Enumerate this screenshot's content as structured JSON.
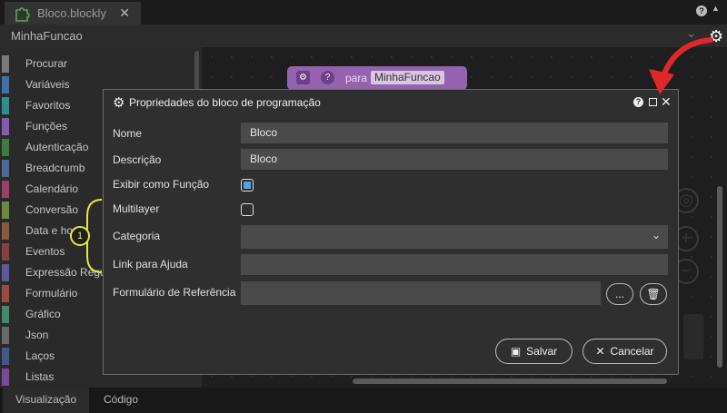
{
  "tab": {
    "title": "Bloco.blockly",
    "close": "✕",
    "icon": "puzzle-icon"
  },
  "top": {
    "help": "?"
  },
  "titlebar": {
    "function_name": "MinhaFuncao",
    "icon_settings": "gear-icon"
  },
  "sidebar": {
    "items": [
      {
        "label": "Procurar",
        "color": "#7a7a7a"
      },
      {
        "label": "Variáveis",
        "color": "#3f6fb0"
      },
      {
        "label": "Favoritos",
        "color": "#2f8f8f"
      },
      {
        "label": "Funções",
        "color": "#8a5ab0"
      },
      {
        "label": "Autenticação",
        "color": "#3f7a3f"
      },
      {
        "label": "Breadcrumb",
        "color": "#4a6a9a"
      },
      {
        "label": "Calendário",
        "color": "#9a3f6a"
      },
      {
        "label": "Conversão",
        "color": "#6a8a3f"
      },
      {
        "label": "Data e hora",
        "color": "#8a5a3f"
      },
      {
        "label": "Eventos",
        "color": "#8a3f3f"
      },
      {
        "label": "Expressão Regular",
        "color": "#5a5aa0"
      },
      {
        "label": "Formulário",
        "color": "#a04a3f"
      },
      {
        "label": "Gráfico",
        "color": "#3f8a6a"
      },
      {
        "label": "Json",
        "color": "#6a6a6a"
      },
      {
        "label": "Laços",
        "color": "#3f5a8a"
      },
      {
        "label": "Listas",
        "color": "#7a4a9a"
      }
    ]
  },
  "block": {
    "para_label": "para",
    "function_name": "MinhaFuncao"
  },
  "bottom_tabs": [
    {
      "label": "Visualização"
    },
    {
      "label": "Código"
    }
  ],
  "dialog": {
    "title": "Propriedades do bloco de programação",
    "help": "?",
    "close": "✕",
    "fields": {
      "nome_label": "Nome",
      "nome_value": "Bloco",
      "descricao_label": "Descrição",
      "descricao_value": "Bloco",
      "exibir_label": "Exibir como Função",
      "multilayer_label": "Multilayer",
      "categoria_label": "Categoria",
      "categoria_value": "",
      "link_label": "Link para Ajuda",
      "link_value": "",
      "formulario_label": "Formulário de Referência",
      "formulario_value": ""
    },
    "checkboxes": {
      "exibir_checked": true,
      "multilayer_checked": false
    },
    "browse_label": "...",
    "save_label": "Salvar",
    "cancel_label": "Cancelar"
  },
  "annotation": {
    "number": "1",
    "color": "#e6e640",
    "arrow_color": "#e0282a"
  }
}
